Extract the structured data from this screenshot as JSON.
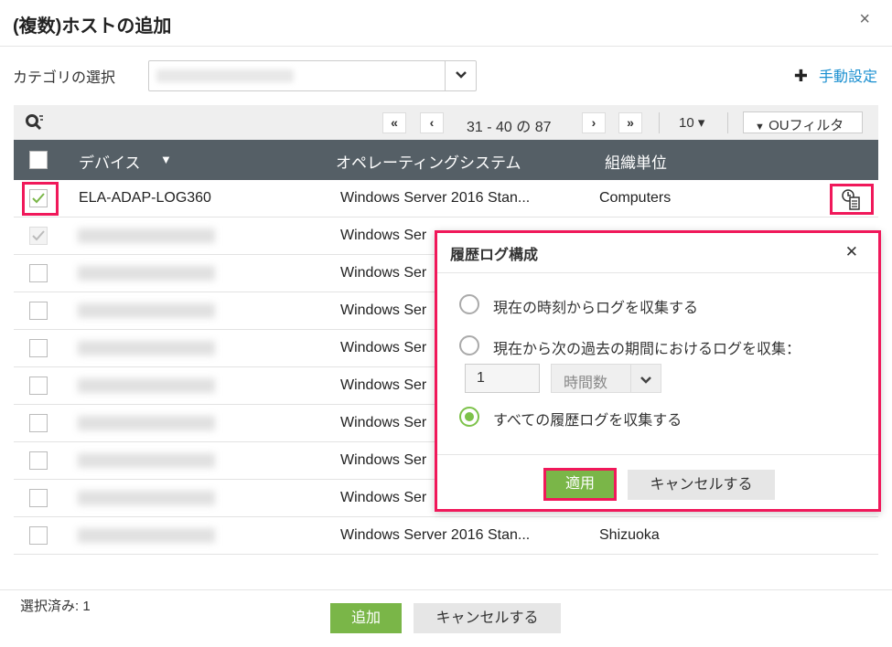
{
  "dialog": {
    "title": "(複数)ホストの追加",
    "close": "×"
  },
  "category": {
    "label": "カテゴリの選択",
    "value": ""
  },
  "manual": {
    "icon": "plus-icon",
    "label": "手動設定"
  },
  "pagination": {
    "first": "«",
    "prev": "‹",
    "range": "31 - 40 の 87",
    "next": "›",
    "last": "»",
    "per_page": "10 ▾",
    "ou_filter": "OUフィルタ"
  },
  "table": {
    "columns": [
      "デバイス",
      "オペレーティングシステム",
      "組織単位"
    ],
    "rows": [
      {
        "device": "ELA-ADAP-LOG360",
        "os": "Windows Server 2016 Stan...",
        "ou": "Computers",
        "state": "checked"
      },
      {
        "device": "",
        "os": "Windows Ser",
        "ou": "",
        "state": "checked-disabled"
      },
      {
        "device": "",
        "os": "Windows Ser",
        "ou": "",
        "state": "unchecked"
      },
      {
        "device": "",
        "os": "Windows Ser",
        "ou": "",
        "state": "unchecked"
      },
      {
        "device": "",
        "os": "Windows Ser",
        "ou": "",
        "state": "unchecked"
      },
      {
        "device": "",
        "os": "Windows Ser",
        "ou": "",
        "state": "unchecked"
      },
      {
        "device": "",
        "os": "Windows Ser",
        "ou": "",
        "state": "unchecked"
      },
      {
        "device": "",
        "os": "Windows Ser",
        "ou": "",
        "state": "unchecked"
      },
      {
        "device": "",
        "os": "Windows Ser",
        "ou": "",
        "state": "unchecked"
      },
      {
        "device": "",
        "os": "Windows Server 2016 Stan...",
        "ou": "Shizuoka",
        "state": "unchecked"
      }
    ]
  },
  "popup": {
    "title": "履歴ログ構成",
    "close": "✕",
    "options": [
      "現在の時刻からログを収集する",
      "現在から次の過去の期間におけるログを収集：",
      "すべての履歴ログを収集する"
    ],
    "selected": 2,
    "period_value": "1",
    "period_unit": "時間数",
    "apply": "適用",
    "cancel": "キャンセルする"
  },
  "footer": {
    "selected": "選択済み: 1",
    "add": "追加",
    "cancel": "キャンセルする"
  },
  "colors": {
    "accent": "#7ab648",
    "highlight": "#f0185a",
    "header": "#555f66",
    "link": "#1a8fd0"
  }
}
